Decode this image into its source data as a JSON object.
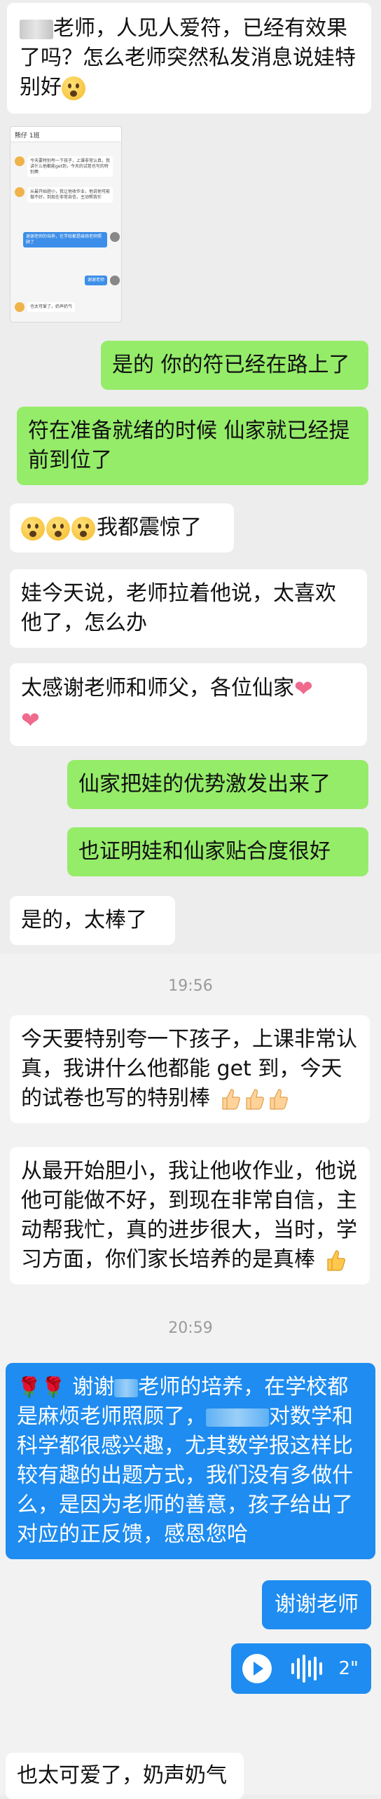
{
  "messages": {
    "m1": {
      "pre": "",
      "text": "老师，人见人爱符，已经有效果了吗？怎么老师突然私发消息说娃特别好"
    },
    "m2": {
      "text": "是的 你的符已经在路上了"
    },
    "m3": {
      "text": "符在准备就绪的时候 仙家就已经提前到位了"
    },
    "m4": {
      "text": "我都震惊了"
    },
    "m5": {
      "text": "娃今天说，老师拉着他说，太喜欢他了，怎么办"
    },
    "m6": {
      "text": "太感谢老师和师父，各位仙家"
    },
    "m7": {
      "text": "仙家把娃的优势激发出来了"
    },
    "m8": {
      "text": "也证明娃和仙家贴合度很好"
    },
    "m9": {
      "text": "是的，太棒了"
    }
  },
  "embedded_screenshot": {
    "title": "熊仔 1班",
    "lines": [
      "今天要特别夸一下孩子，上课非常认真，我讲什么他都能get到，今天的试卷也写的特别棒",
      "从最开始胆小，我让他收作业，他说他可能做不好，到现在非常自信，主动帮我忙",
      "谢谢老师的培养，在学校都是麻烦老师照顾了",
      "谢谢老师",
      "也太可爱了，奶声奶气"
    ]
  },
  "times": {
    "t1": "19:56",
    "t2": "20:59"
  },
  "teacher": {
    "msg1": "今天要特别夸一下孩子，上课非常认真，我讲什么他都能 get 到，今天的试卷也写的特别棒",
    "msg2": "从最开始胆小，我让他收作业，他说他可能做不好，到现在非常自信，主动帮我忙，真的进步很大，当时，学习方面，你们家长培养的是真棒"
  },
  "parent": {
    "msg1_pre": "谢谢",
    "msg1_mid": "老师的培养，在学校都是麻烦老师照顾了，",
    "msg1_post": "对数学和科学都很感兴趣，尤其数学报这样比较有趣的出题方式，我们没有多做什么，是因为老师的善意，孩子给出了对应的正反馈，感恩您哈",
    "msg2": "谢谢老师",
    "voice_duration": "2\"",
    "last": "也太可爱了，奶声奶气"
  },
  "colors": {
    "green": "#95ec69",
    "blue": "#1e8cf0",
    "white": "#ffffff"
  }
}
